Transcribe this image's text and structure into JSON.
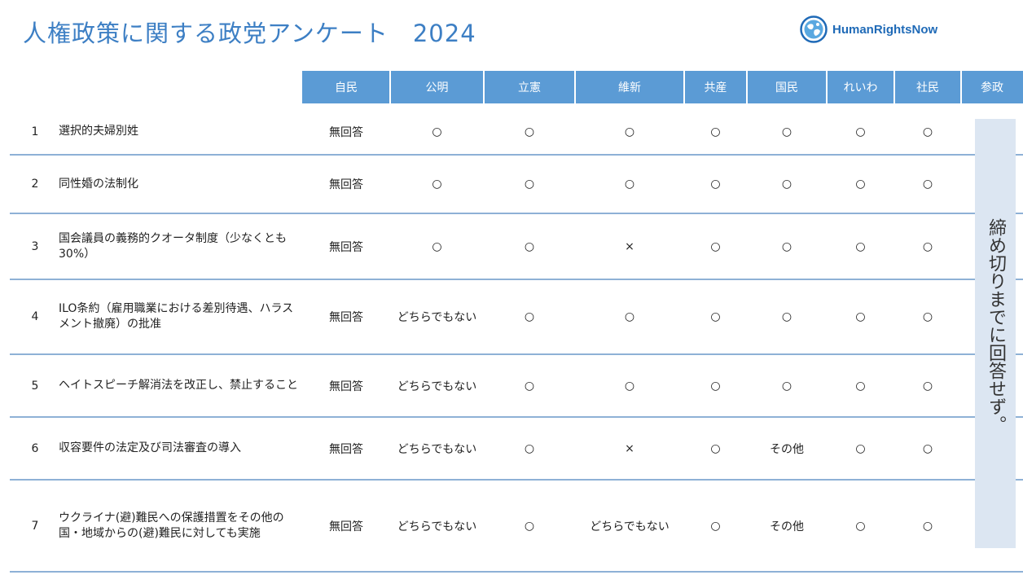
{
  "title": "人権政策に関する政党アンケート　2024",
  "logo": {
    "text": "HumanRightsNow",
    "icon": "globe-icon"
  },
  "parties": [
    "自民",
    "公明",
    "立憲",
    "維新",
    "共産",
    "国民",
    "れいわ",
    "社民",
    "参政"
  ],
  "note": "締め切りまでに回答せず。",
  "rows": [
    {
      "num": "1",
      "question": "選択的夫婦別姓",
      "answers": [
        "無回答",
        "○",
        "○",
        "○",
        "○",
        "○",
        "○",
        "○"
      ]
    },
    {
      "num": "2",
      "question": "同性婚の法制化",
      "answers": [
        "無回答",
        "○",
        "○",
        "○",
        "○",
        "○",
        "○",
        "○"
      ]
    },
    {
      "num": "3",
      "question": "国会議員の義務的クオータ制度（少なくとも30%）",
      "answers": [
        "無回答",
        "○",
        "○",
        "×",
        "○",
        "○",
        "○",
        "○"
      ]
    },
    {
      "num": "4",
      "question": "ILO条約（雇用職業における差別待遇、ハラスメント撤廃）の批准",
      "answers": [
        "無回答",
        "どちらでもない",
        "○",
        "○",
        "○",
        "○",
        "○",
        "○"
      ]
    },
    {
      "num": "5",
      "question": "ヘイトスピーチ解消法を改正し、禁止すること",
      "answers": [
        "無回答",
        "どちらでもない",
        "○",
        "○",
        "○",
        "○",
        "○",
        "○"
      ]
    },
    {
      "num": "6",
      "question": "収容要件の法定及び司法審査の導入",
      "answers": [
        "無回答",
        "どちらでもない",
        "○",
        "×",
        "○",
        "その他",
        "○",
        "○"
      ]
    },
    {
      "num": "7",
      "question": "ウクライナ(避)難民への保護措置をその他の国・地域からの(避)難民に対しても実施",
      "answers": [
        "無回答",
        "どちらでもない",
        "○",
        "どちらでもない",
        "○",
        "その他",
        "○",
        "○"
      ]
    }
  ],
  "colors": {
    "title": "#3d7fc4",
    "header_bg": "#5b9bd5",
    "note_bg": "#dce6f2",
    "rule": "#8eb1d6"
  }
}
